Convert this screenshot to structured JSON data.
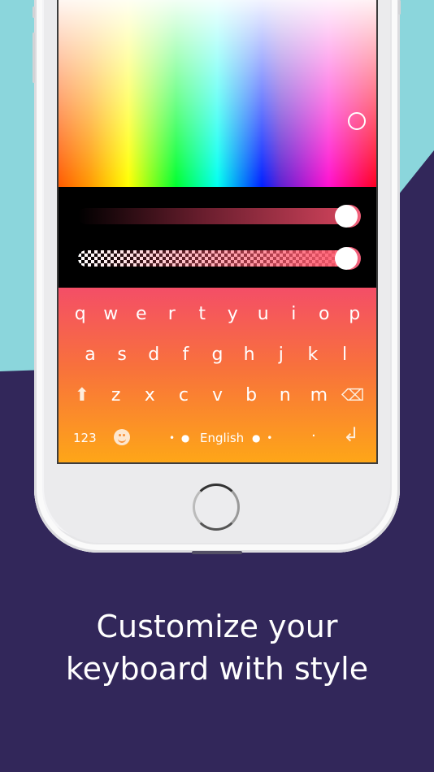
{
  "colors": {
    "background_primary": "#32275a",
    "background_accent": "#8bd6dc",
    "keyboard_gradient_top": "#f44e67",
    "keyboard_gradient_bottom": "#fea717",
    "selected_color": "#f0607a"
  },
  "color_picker": {
    "brightness_value": 1.0,
    "opacity_value": 1.0
  },
  "keyboard": {
    "row1": [
      "q",
      "w",
      "e",
      "r",
      "t",
      "y",
      "u",
      "i",
      "o",
      "p"
    ],
    "row2": [
      "a",
      "s",
      "d",
      "f",
      "g",
      "h",
      "j",
      "k",
      "l"
    ],
    "row3": [
      "z",
      "x",
      "c",
      "v",
      "b",
      "n",
      "m"
    ],
    "shift_icon": "⬆",
    "backspace_icon": "⌫",
    "numbers_label": "123",
    "emoji_icon": "smiley",
    "page_dots_left": "• ●",
    "language_label": "English",
    "page_dots_right": "● •",
    "period_label": ".",
    "return_icon": "↲"
  },
  "headline": {
    "line1": "Customize your",
    "line2": "keyboard with style"
  }
}
